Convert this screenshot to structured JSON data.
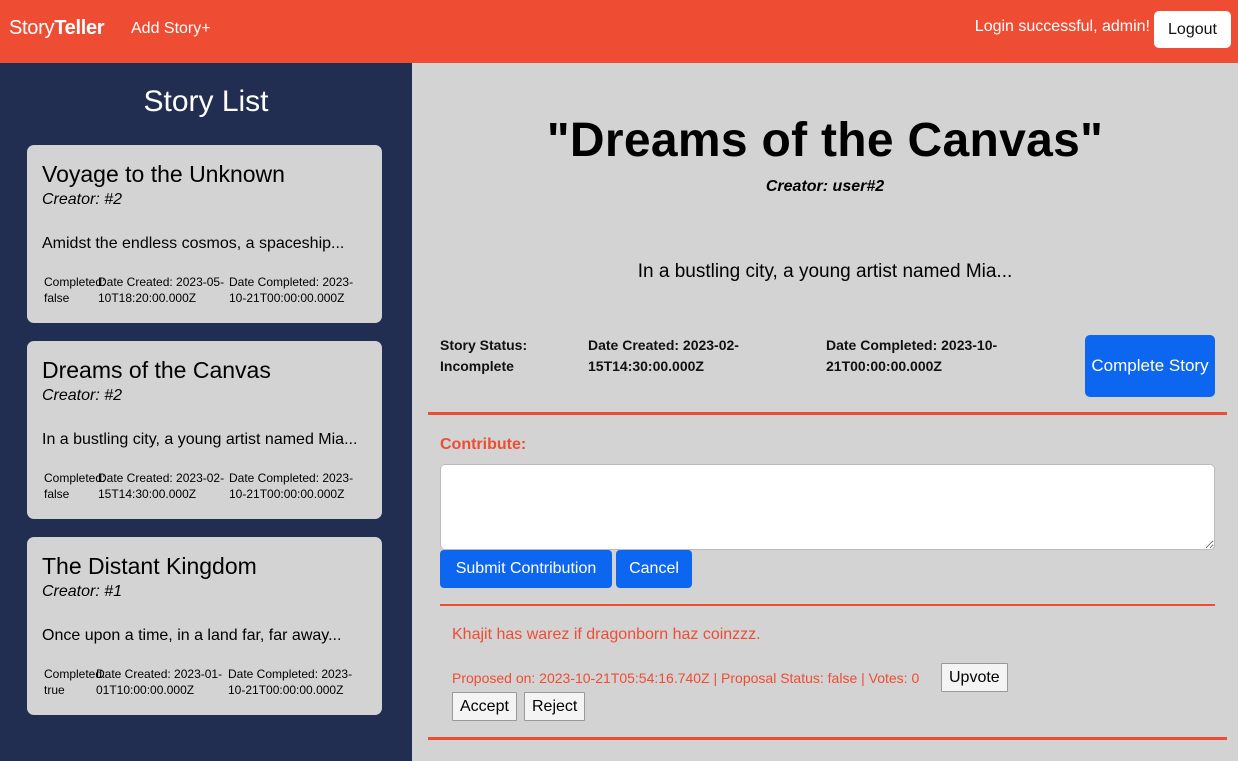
{
  "header": {
    "brand_part1": "Story",
    "brand_part2": "Teller",
    "add_story": "Add Story+",
    "login_message": "Login successful, admin!",
    "logout_label": "Logout"
  },
  "sidebar": {
    "title": "Story List",
    "stories": [
      {
        "title": "Voyage to the Unknown",
        "creator": "Creator: #2",
        "excerpt": "Amidst the endless cosmos, a spaceship...",
        "completed": "Completed: false",
        "date_created": "Date Created: 2023-05-10T18:20:00.000Z",
        "date_completed": "Date Completed: 2023-10-21T00:00:00.000Z"
      },
      {
        "title": "Dreams of the Canvas",
        "creator": "Creator: #2",
        "excerpt": "In a bustling city, a young artist named Mia...",
        "completed": "Completed: false",
        "date_created": "Date Created: 2023-02-15T14:30:00.000Z",
        "date_completed": "Date Completed: 2023-10-21T00:00:00.000Z"
      },
      {
        "title": "The Distant Kingdom",
        "creator": "Creator: #1",
        "excerpt": "Once upon a time, in a land far, far away...",
        "completed": "Completed: true",
        "date_created": "Date Created: 2023-01-01T10:00:00.000Z",
        "date_completed": "Date Completed: 2023-10-21T00:00:00.000Z"
      }
    ]
  },
  "story": {
    "title": "\"Dreams of the Canvas\"",
    "creator": "Creator: user#2",
    "excerpt": "In a bustling city, a young artist named Mia...",
    "status": "Story Status: Incomplete",
    "date_created": "Date Created: 2023-02-15T14:30:00.000Z",
    "date_completed": "Date Completed: 2023-10-21T00:00:00.000Z",
    "complete_button": "Complete Story"
  },
  "contribute": {
    "label": "Contribute:",
    "input_value": "",
    "submit_label": "Submit Contribution",
    "cancel_label": "Cancel"
  },
  "proposal": {
    "text": "Khajit has warez if dragonborn haz coinzzz.",
    "meta": "Proposed on: 2023-10-21T05:54:16.740Z | Proposal Status: false | Votes: 0",
    "upvote_label": "Upvote",
    "accept_label": "Accept",
    "reject_label": "Reject"
  },
  "colors": {
    "accent": "#ee4d33",
    "sidebar_bg": "#222d52",
    "primary_button": "#0d66f0",
    "content_bg": "#d3d3d3"
  }
}
